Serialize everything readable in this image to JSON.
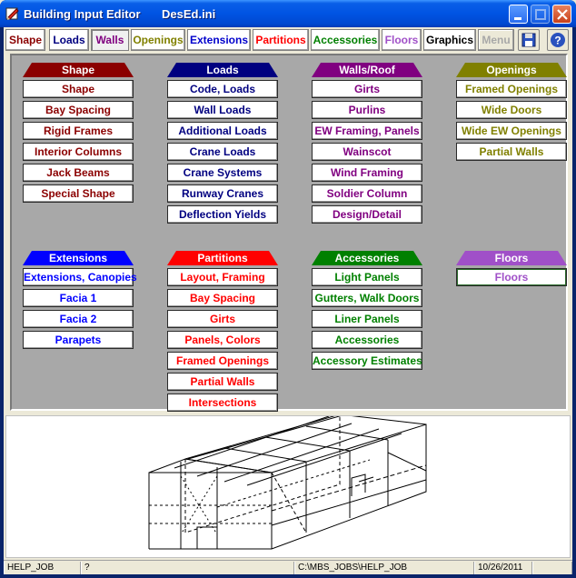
{
  "window": {
    "title": "Building Input Editor",
    "file": "DesEd.ini"
  },
  "toolbar": {
    "tabs": [
      {
        "label": "Shape",
        "color": "#8b0000"
      },
      {
        "label": "Loads",
        "color": "#000080"
      },
      {
        "label": "Walls",
        "color": "#800080"
      },
      {
        "label": "Openings",
        "color": "#808000"
      },
      {
        "label": "Extensions",
        "color": "#0000cc"
      },
      {
        "label": "Partitions",
        "color": "#ff0000"
      },
      {
        "label": "Accessories",
        "color": "#008000"
      },
      {
        "label": "Floors",
        "color": "#a050c8"
      },
      {
        "label": "Graphics",
        "color": "#000000"
      },
      {
        "label": "Menu",
        "color": "#a8a8a8"
      }
    ],
    "save_icon": "floppy-disk-icon",
    "help_icon": "help-question-icon"
  },
  "groups": {
    "shape": {
      "title": "Shape",
      "color": "#8b0000",
      "items": [
        "Shape",
        "Bay Spacing",
        "Rigid Frames",
        "Interior Columns",
        "Jack Beams",
        "Special Shape"
      ]
    },
    "loads": {
      "title": "Loads",
      "color": "#000080",
      "items": [
        "Code, Loads",
        "Wall Loads",
        "Additional Loads",
        "Crane Loads",
        "Crane Systems",
        "Runway Cranes",
        "Deflection Yields"
      ]
    },
    "walls": {
      "title": "Walls/Roof",
      "color": "#800080",
      "items": [
        "Girts",
        "Purlins",
        "EW Framing, Panels",
        "Wainscot",
        "Wind Framing",
        "Soldier Column",
        "Design/Detail"
      ]
    },
    "openings": {
      "title": "Openings",
      "color": "#808000",
      "items": [
        "Framed Openings",
        "Wide Doors",
        "Wide EW Openings",
        "Partial Walls"
      ]
    },
    "extensions": {
      "title": "Extensions",
      "color": "#0000ff",
      "items": [
        "Extensions, Canopies",
        "Facia 1",
        "Facia 2",
        "Parapets"
      ]
    },
    "partitions": {
      "title": "Partitions",
      "color": "#ff0000",
      "items": [
        "Layout, Framing",
        "Bay Spacing",
        "Girts",
        "Panels, Colors",
        "Framed Openings",
        "Partial Walls",
        "Intersections"
      ]
    },
    "accessories": {
      "title": "Accessories",
      "color": "#008000",
      "items": [
        "Light Panels",
        "Gutters, Walk Doors",
        "Liner Panels",
        "Accessories",
        "Accessory Estimates"
      ]
    },
    "floors": {
      "title": "Floors",
      "color": "#a050c8",
      "items": [
        "Floors"
      ]
    }
  },
  "status": {
    "job": "HELP_JOB",
    "help": "?",
    "path": "C:\\MBS_JOBS\\HELP_JOB",
    "date": "10/26/2011"
  }
}
